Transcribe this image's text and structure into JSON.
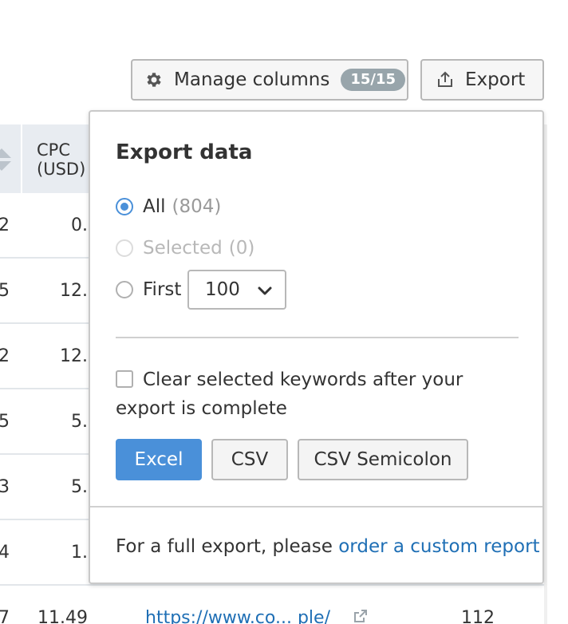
{
  "toolbar": {
    "manage_label": "Manage columns",
    "manage_badge": "15/15",
    "export_label": "Export"
  },
  "table": {
    "header_cpc": "CPC\n(USD)",
    "rows": [
      {
        "c0": "2",
        "c1": "0."
      },
      {
        "c0": "5",
        "c1": "12."
      },
      {
        "c0": "2",
        "c1": "12."
      },
      {
        "c0": "5",
        "c1": "5."
      },
      {
        "c0": "3",
        "c1": "5."
      },
      {
        "c0": "4",
        "c1": "1."
      },
      {
        "c0": "7",
        "c1": "11.49",
        "c2": "https://www.co... ple/",
        "c3": "112"
      }
    ]
  },
  "export_popup": {
    "title": "Export data",
    "option_all": "All",
    "option_all_count": "(804)",
    "option_selected": "Selected",
    "option_selected_count": "(0)",
    "option_first": "First",
    "first_value": "100",
    "clear_checkbox_label": "Clear selected keywords after your export is complete",
    "buttons": {
      "excel": "Excel",
      "csv": "CSV",
      "csv_semicolon": "CSV Semicolon"
    },
    "footer_text": "For a full export, please ",
    "footer_link": "order a custom report"
  },
  "colors": {
    "accent": "#4a90d9",
    "link": "#1f6fb5",
    "badge": "#98a5ab"
  }
}
